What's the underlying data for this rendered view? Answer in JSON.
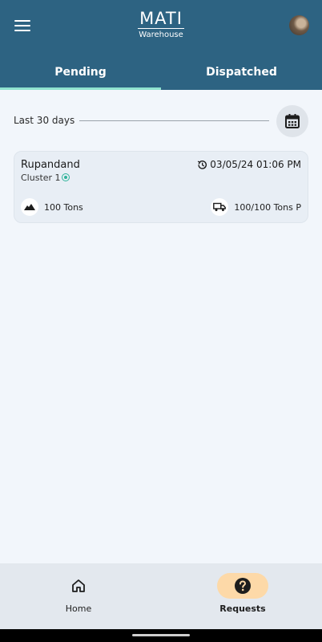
{
  "header": {
    "logo_main": "MATI",
    "logo_sub": "Warehouse",
    "menu_icon": "menu-icon",
    "avatar_icon": "avatar"
  },
  "tabs": [
    {
      "label": "Pending",
      "active": true
    },
    {
      "label": "Dispatched",
      "active": false
    }
  ],
  "filter": {
    "label": "Last 30 days",
    "calendar_icon": "calendar-icon"
  },
  "requests": [
    {
      "title": "Rupandand",
      "cluster": "Cluster 1",
      "datetime": "03/05/24 01:06 PM",
      "quantity": "100 Tons",
      "dispatch": "100/100 Tons P"
    }
  ],
  "bottom_nav": {
    "home_label": "Home",
    "requests_label": "Requests"
  },
  "colors": {
    "primary": "#2d6382",
    "tab_indicator": "#8fe3cf",
    "active_nav": "#fdd9a8",
    "background": "#f2f6fb"
  }
}
